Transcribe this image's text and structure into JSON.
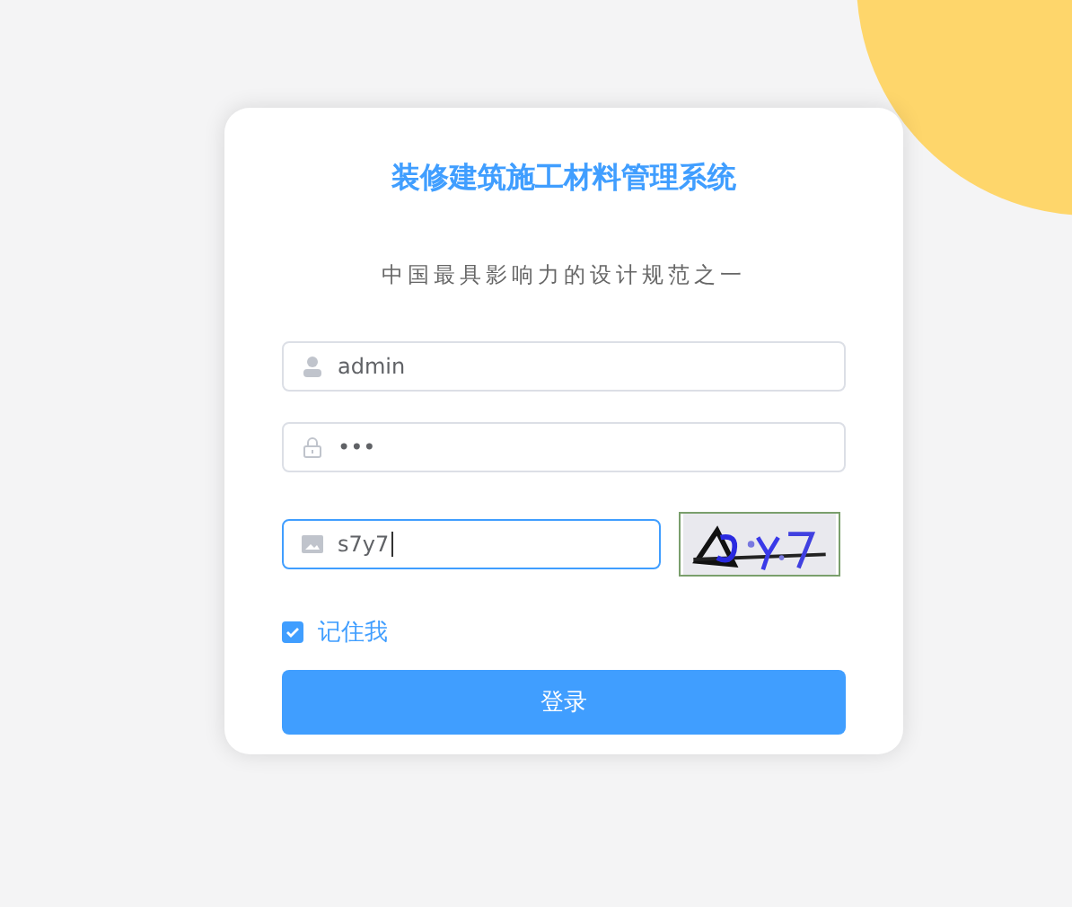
{
  "title": "装修建筑施工材料管理系统",
  "subtitle": "中国最具影响力的设计规范之一",
  "fields": [
    {
      "kind": "user",
      "value": "admin",
      "focused": false
    },
    {
      "kind": "lock",
      "value": "•••",
      "focused": false
    },
    {
      "kind": "captcha",
      "value": "s7y7",
      "focused": true
    }
  ],
  "remember": {
    "label": "记住我",
    "checked": true
  },
  "login_button": "登录"
}
